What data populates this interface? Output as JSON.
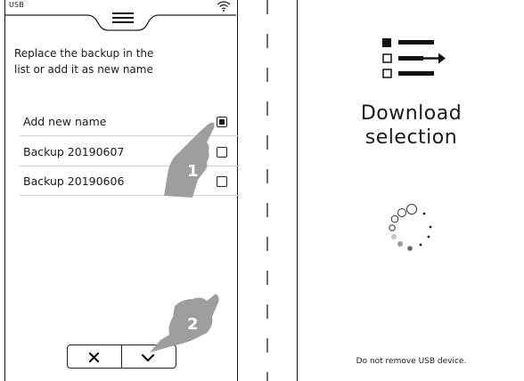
{
  "left_screen": {
    "status": {
      "usb_label": "USB",
      "wifi_icon": "wifi-icon",
      "menu_icon": "hamburger-menu-icon"
    },
    "intro_line1": "Replace the backup in the",
    "intro_line2": "list or add it as new name",
    "items": [
      {
        "label": "Add new name",
        "checked": true
      },
      {
        "label": "Backup 20190607",
        "checked": false
      },
      {
        "label": "Backup 20190606",
        "checked": false
      }
    ],
    "gesture_steps": [
      "1",
      "2"
    ],
    "buttons": {
      "cancel_icon": "x-icon",
      "confirm_icon": "checkmark-icon"
    }
  },
  "right_screen": {
    "icon": "list-selection-icon",
    "title_line1": "Download",
    "title_line2": "selection",
    "spinner": "loading-spinner-icon",
    "footer": "Do not remove USB device."
  }
}
